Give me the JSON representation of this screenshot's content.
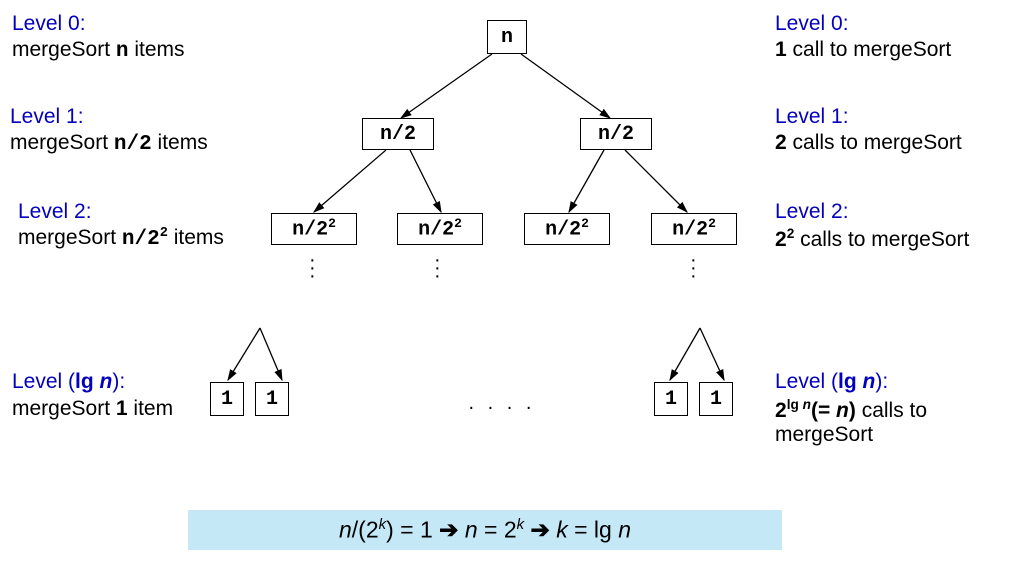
{
  "left": {
    "l0_label": "Level 0:",
    "l0_desc_a": "mergeSort ",
    "l0_desc_b": "n",
    "l0_desc_c": " items",
    "l1_label": "Level 1:",
    "l1_desc_a": "mergeSort ",
    "l1_desc_b": "n/2",
    "l1_desc_c": " items",
    "l2_label": "Level 2:",
    "l2_desc_a": "mergeSort ",
    "l2_desc_b": "n/2",
    "l2_desc_sup": "2",
    "l2_desc_c": " items",
    "lk_label_a": "Level (",
    "lk_label_b": "lg ",
    "lk_label_c": "n",
    "lk_label_d": "):",
    "lk_desc_a": "mergeSort ",
    "lk_desc_b": "1",
    "lk_desc_c": " item"
  },
  "right": {
    "l0_label": "Level 0:",
    "l0_desc_a": "1",
    "l0_desc_b": " call to mergeSort",
    "l1_label": "Level 1:",
    "l1_desc_a": "2",
    "l1_desc_b": " calls to mergeSort",
    "l2_label": "Level 2:",
    "l2_desc_a": "2",
    "l2_desc_sup": "2",
    "l2_desc_b": " calls to mergeSort",
    "lk_label_a": "Level (",
    "lk_label_b": "lg ",
    "lk_label_c": "n",
    "lk_label_d": "):",
    "lk_desc_a": "2",
    "lk_desc_sup": "lg ",
    "lk_desc_supn": "n",
    "lk_desc_b": "(= ",
    "lk_desc_c": "n",
    "lk_desc_d": ")",
    "lk_desc_e": " calls to",
    "lk_desc_f": "mergeSort"
  },
  "nodes": {
    "root": "n",
    "l1": "n/2",
    "l2_a": "n/2",
    "l2_sup": "2",
    "leaf": "1"
  },
  "dots_center": ".  .  .  .",
  "formula": {
    "a": "n",
    "b": "/(2",
    "c": "k",
    "d": ") = 1  ",
    "arr": "➔",
    "e": "  n",
    "f": " = 2",
    "g": "k",
    "h": "  ",
    "i": "  k",
    "j": " = lg ",
    "k": "n"
  },
  "chart_data": {
    "type": "tree-diagram",
    "title": "mergeSort recursion tree",
    "levels": [
      {
        "level": 0,
        "node_value": "n",
        "num_calls": "1",
        "items_per_call": "n"
      },
      {
        "level": 1,
        "node_value": "n/2",
        "num_calls": "2",
        "items_per_call": "n/2"
      },
      {
        "level": 2,
        "node_value": "n/2^2",
        "num_calls": "2^2",
        "items_per_call": "n/2^2"
      },
      {
        "level": "lg n",
        "node_value": "1",
        "num_calls": "2^(lg n) = n",
        "items_per_call": "1"
      }
    ],
    "equation": "n/(2^k) = 1  ⇒  n = 2^k  ⇒  k = lg n"
  }
}
